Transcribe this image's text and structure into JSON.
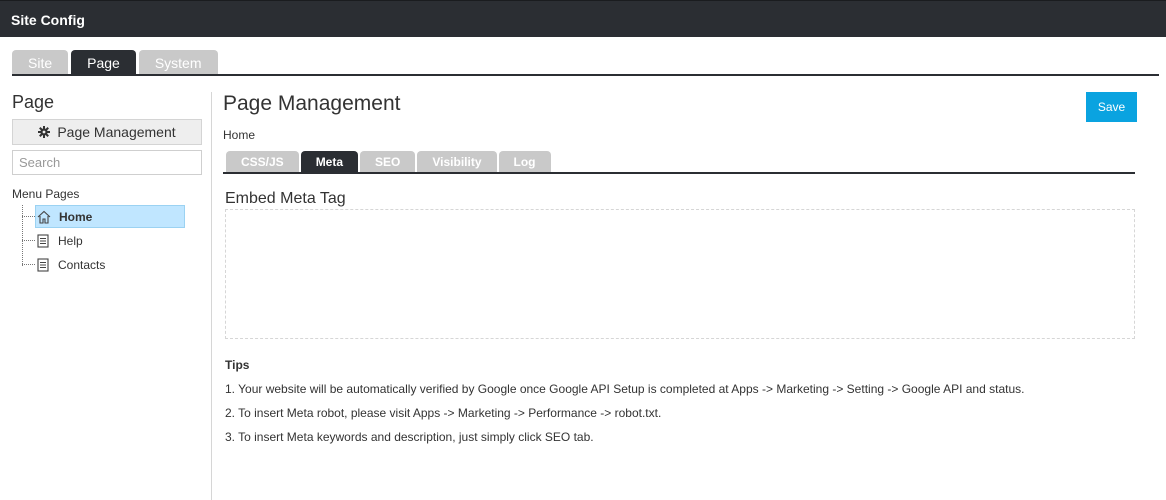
{
  "titlebar": {
    "title": "Site Config"
  },
  "main_tabs": [
    {
      "label": "Site",
      "active": false
    },
    {
      "label": "Page",
      "active": true
    },
    {
      "label": "System",
      "active": false
    }
  ],
  "sidebar": {
    "title": "Page",
    "page_management_label": "Page Management",
    "search_placeholder": "Search",
    "menu_pages_label": "Menu Pages",
    "tree": [
      {
        "label": "Home",
        "icon": "home-icon",
        "selected": true
      },
      {
        "label": "Help",
        "icon": "page-icon",
        "selected": false
      },
      {
        "label": "Contacts",
        "icon": "page-icon",
        "selected": false
      }
    ]
  },
  "content": {
    "title": "Page Management",
    "save_label": "Save",
    "breadcrumb": "Home",
    "sub_tabs": [
      {
        "label": "CSS/JS",
        "active": false
      },
      {
        "label": "Meta",
        "active": true
      },
      {
        "label": "SEO",
        "active": false
      },
      {
        "label": "Visibility",
        "active": false
      },
      {
        "label": "Log",
        "active": false
      }
    ],
    "section_label": "Embed Meta Tag",
    "embed_meta_value": "",
    "tips": {
      "title": "Tips",
      "lines": [
        "1. Your website will be automatically verified by Google once Google API Setup is completed at Apps -> Marketing -> Setting -> Google API and status.",
        "2. To insert Meta robot, please visit Apps -> Marketing -> Performance -> robot.txt.",
        "3. To insert Meta keywords and description, just simply click SEO tab."
      ]
    }
  },
  "colors": {
    "titlebar_bg": "#2b2e33",
    "tab_active_bg": "#2b2e33",
    "tab_inactive_bg": "#c9c9c9",
    "save_button_bg": "#0aa3e0",
    "tree_selected_bg": "#c0e6ff"
  }
}
